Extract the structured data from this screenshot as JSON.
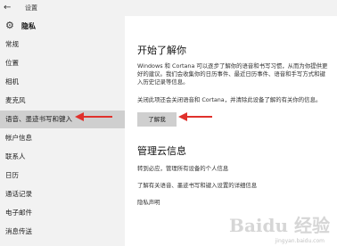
{
  "window": {
    "title": "设置"
  },
  "header": {
    "title": "隐私"
  },
  "sidebar": {
    "items": [
      {
        "label": "常规"
      },
      {
        "label": "位置"
      },
      {
        "label": "相机"
      },
      {
        "label": "麦克风"
      },
      {
        "label": "语音、墨迹书写和键入"
      },
      {
        "label": "帐户信息"
      },
      {
        "label": "联系人"
      },
      {
        "label": "日历"
      },
      {
        "label": "通话记录"
      },
      {
        "label": "电子邮件"
      },
      {
        "label": "消息传送"
      }
    ]
  },
  "main": {
    "section1": {
      "title": "开始了解你",
      "desc": "Windows 和 Cortana 可以逐步了解你的语音和书写习惯，从而为你提供更好的建议。我们会收集你的日历事件、最近日历事件、语音和手写方式和键入历史记录等信息。",
      "desc2": "关闭此项还会关闭语音和 Cortana，并清除此设备了解的有关你的信息。",
      "button": "了解我"
    },
    "section2": {
      "title": "管理云信息",
      "link1": "转到必应，管理所有设备的个人信息",
      "link2": "了解有关语音、墨迹书写和键入设置的详细信息",
      "link3": "隐私声明"
    }
  },
  "watermark": {
    "text": "Baidu 经验",
    "sub": "jingyan.baidu.com"
  },
  "colors": {
    "sidebar_bg": "#f2f2f2",
    "selected_bg": "#cfcfcf",
    "arrow": "#e0312c"
  }
}
